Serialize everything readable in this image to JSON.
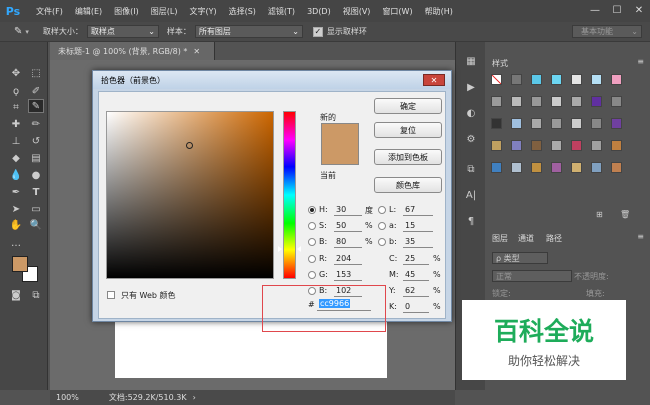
{
  "app": {
    "logo": "Ps"
  },
  "menu": [
    "文件(F)",
    "编辑(E)",
    "图像(I)",
    "图层(L)",
    "文字(Y)",
    "选择(S)",
    "滤镜(T)",
    "3D(D)",
    "视图(V)",
    "窗口(W)",
    "帮助(H)"
  ],
  "window_buttons": [
    "—",
    "☐",
    "✕"
  ],
  "options": {
    "sample_size_label": "取样大小：",
    "sample_size_value": "取样点",
    "sample_label": "样本：",
    "sample_value": "所有图层",
    "show_ring_label": "显示取样环",
    "workspace": "基本功能"
  },
  "document": {
    "tab_title": "未标题-1 @ 100% (背景, RGB/8) *",
    "close": "✕",
    "zoom": "100%",
    "doc_info": "文档:529.2K/510.3K"
  },
  "dialog": {
    "title": "拾色器（前景色）",
    "close": "✕",
    "new_label": "新的",
    "current_label": "当前",
    "buttons": {
      "ok": "确定",
      "reset": "复位",
      "add_swatch": "添加到色板",
      "color_libraries": "颜色库"
    },
    "only_web_label": "只有 Web 颜色",
    "hsb": {
      "H": "30",
      "S": "50",
      "B": "80",
      "h_unit": "度",
      "pct": "%"
    },
    "rgb": {
      "R": "204",
      "G": "153",
      "B": "102"
    },
    "lab": {
      "L": "67",
      "a": "15",
      "b": "35"
    },
    "cmyk": {
      "C": "25",
      "M": "45",
      "Y": "62",
      "K": "0"
    },
    "hex_label": "#",
    "hex": "cc9966",
    "new_color": "#cc9966",
    "hue_position_fraction": 0.92
  },
  "swatches_panel": {
    "tab": "样式"
  },
  "layers_panel": {
    "tabs": [
      "图层",
      "通道",
      "路径"
    ],
    "kind_label": "ρ 类型",
    "blend_mode": "正常",
    "opacity_label": "不透明度:",
    "lock_label": "锁定:",
    "fill_label": "填充:"
  },
  "watermark": {
    "title": "百科全说",
    "subtitle": "助你轻松解决"
  },
  "colors": {
    "foreground": "#cc9966",
    "background": "#ffffff",
    "accent": "#31a8ff",
    "watermark_green": "#1eac5a"
  }
}
